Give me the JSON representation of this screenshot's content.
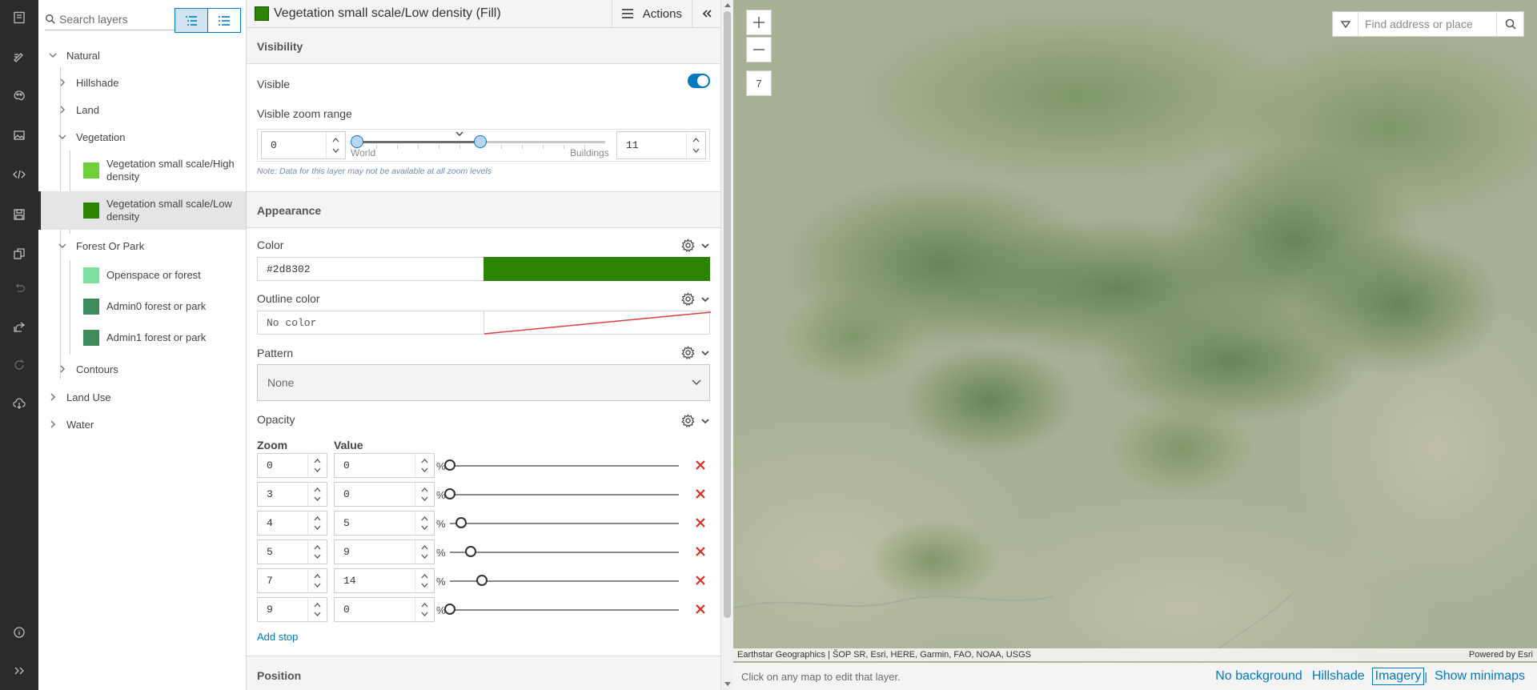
{
  "tree": {
    "search_placeholder": "Search layers",
    "items": [
      {
        "label": "Natural"
      },
      {
        "label": "Hillshade"
      },
      {
        "label": "Land"
      },
      {
        "label": "Vegetation"
      },
      {
        "label": "Vegetation small scale/High density",
        "color": "#6fcf3a"
      },
      {
        "label": "Vegetation small scale/Low density",
        "color": "#2d8302"
      },
      {
        "label": "Forest Or Park"
      },
      {
        "label": "Openspace or forest",
        "color": "#7ee0a0"
      },
      {
        "label": "Admin0 forest or park",
        "color": "#3f8a5a"
      },
      {
        "label": "Admin1 forest or park",
        "color": "#3f8a5a"
      },
      {
        "label": "Contours"
      },
      {
        "label": "Land Use"
      },
      {
        "label": "Water"
      }
    ]
  },
  "editor": {
    "title": "Vegetation small scale/Low density (Fill)",
    "actions_label": "Actions",
    "visibility": {
      "heading": "Visibility",
      "visible_label": "Visible",
      "visible": true,
      "zoom_range_label": "Visible zoom range",
      "min_zoom": "0",
      "max_zoom": "11",
      "world_label": "World",
      "buildings_label": "Buildings",
      "note": "Note: Data for this layer may not be available at all zoom levels"
    },
    "appearance": {
      "heading": "Appearance",
      "color_label": "Color",
      "color_value": "#2d8302",
      "outline_label": "Outline color",
      "outline_value": "No color",
      "pattern_label": "Pattern",
      "pattern_value": "None",
      "opacity_label": "Opacity",
      "zoom_col": "Zoom",
      "value_col": "Value",
      "pct": "%",
      "stops": [
        {
          "zoom": "0",
          "value": "0"
        },
        {
          "zoom": "3",
          "value": "0"
        },
        {
          "zoom": "4",
          "value": "5"
        },
        {
          "zoom": "5",
          "value": "9"
        },
        {
          "zoom": "7",
          "value": "14"
        },
        {
          "zoom": "9",
          "value": "0"
        }
      ],
      "add_stop": "Add stop"
    },
    "position_heading": "Position"
  },
  "map": {
    "zoom_level": "7",
    "search_placeholder": "Find address or place",
    "attribution": "Earthstar Geographics | ŠOP SR, Esri, HERE, Garmin, FAO, NOAA, USGS",
    "powered_by": "Powered by Esri",
    "hint": "Click on any map to edit that layer.",
    "options": [
      "No background",
      "Hillshade",
      "Imagery",
      "Show minimaps"
    ],
    "active_option": "Imagery"
  },
  "colors": {
    "accent": "#0079c1",
    "delete": "#d83020",
    "layer_fill": "#2d8302"
  }
}
